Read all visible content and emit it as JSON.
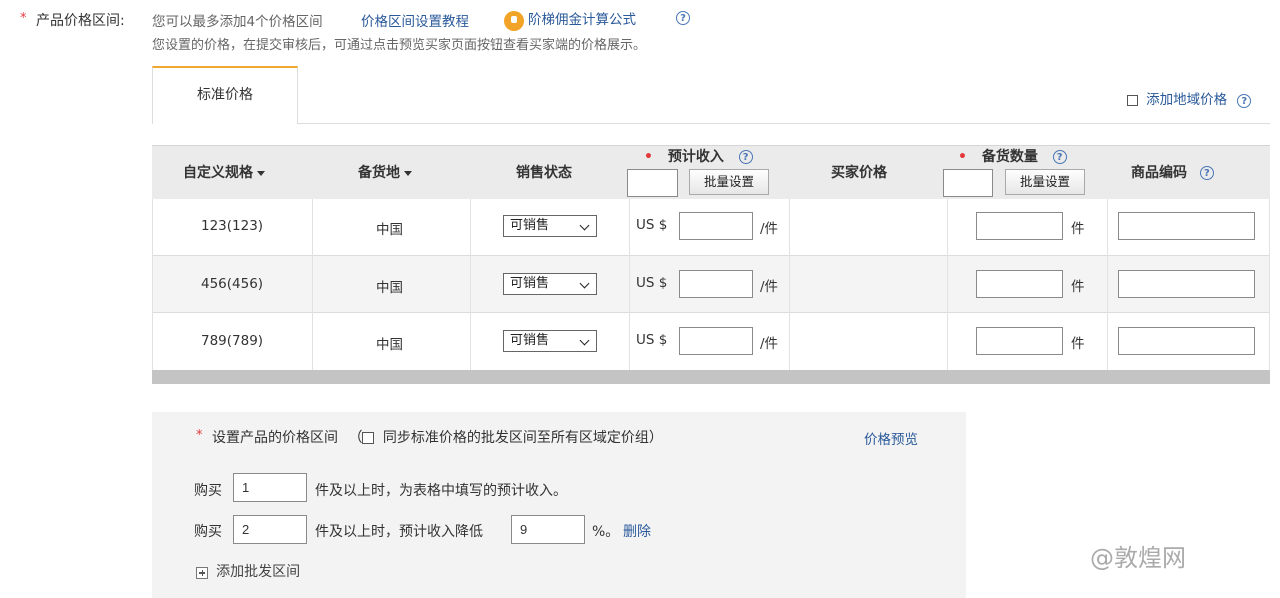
{
  "header": {
    "required_mark": "*",
    "label": "产品价格区间:",
    "hint": "您可以最多添加4个价格区间",
    "tutorial_link": "价格区间设置教程",
    "commission_link": "阶梯佣金计算公式",
    "help": "?",
    "note": "您设置的价格，在提交审核后，可通过点击预览买家页面按钮查看买家端的价格展示。"
  },
  "tabs": {
    "standard": "标准价格",
    "add_region": "添加地域价格",
    "help": "?"
  },
  "table": {
    "columns": {
      "spec": "自定义规格",
      "warehouse": "备货地",
      "status": "销售状态",
      "income": "预计收入",
      "buyer_price": "买家价格",
      "stock": "备货数量",
      "sku": "商品编码"
    },
    "required_mark": "•",
    "help": "?",
    "batch_set": "批量设置",
    "currency": "US $",
    "per_unit": "/件",
    "unit": "件",
    "rows": [
      {
        "spec": "123(123)",
        "warehouse": "中国",
        "status": "可销售"
      },
      {
        "spec": "456(456)",
        "warehouse": "中国",
        "status": "可销售"
      },
      {
        "spec": "789(789)",
        "warehouse": "中国",
        "status": "可销售"
      }
    ]
  },
  "price_range": {
    "required_mark": "*",
    "label": "设置产品的价格区间",
    "sync_open": "（",
    "sync_label": "同步标准价格的批发区间至所有区域定价组）",
    "preview": "价格预览",
    "buy": "购买",
    "row1_qty": "1",
    "row1_text": "件及以上时，为表格中填写的预计收入。",
    "row2_qty": "2",
    "row2_text": "件及以上时，预计收入降低",
    "row2_discount": "9",
    "row2_suffix": "%。",
    "delete": "删除",
    "add": "添加批发区间"
  },
  "watermark": "@敦煌网"
}
